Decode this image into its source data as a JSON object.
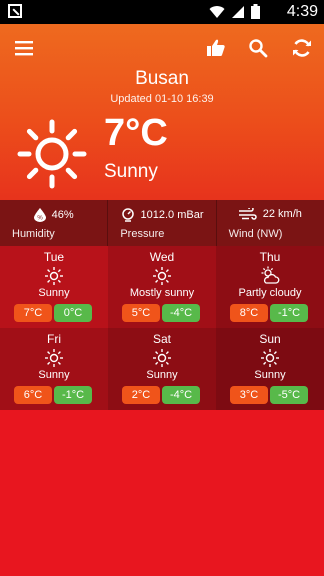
{
  "status_bar": {
    "time": "4:39"
  },
  "header": {
    "city": "Busan",
    "updated": "Updated 01-10 16:39"
  },
  "current": {
    "temperature": "7°C",
    "condition": "Sunny",
    "icon": "sun-icon"
  },
  "metrics": [
    {
      "value": "46%",
      "label": "Humidity",
      "icon": "humidity-icon"
    },
    {
      "value": "1012.0 mBar",
      "label": "Pressure",
      "icon": "pressure-icon"
    },
    {
      "value": "22 km/h",
      "label": "Wind (NW)",
      "icon": "wind-icon"
    }
  ],
  "forecast": [
    {
      "day": "Tue",
      "condition": "Sunny",
      "max": "7°C",
      "min": "0°C",
      "icon": "sun-icon"
    },
    {
      "day": "Wed",
      "condition": "Mostly sunny",
      "max": "5°C",
      "min": "-4°C",
      "icon": "sun-icon"
    },
    {
      "day": "Thu",
      "condition": "Partly cloudy",
      "max": "8°C",
      "min": "-1°C",
      "icon": "partly-cloudy-icon"
    },
    {
      "day": "Fri",
      "condition": "Sunny",
      "max": "6°C",
      "min": "-1°C",
      "icon": "sun-icon"
    },
    {
      "day": "Sat",
      "condition": "Sunny",
      "max": "2°C",
      "min": "-4°C",
      "icon": "sun-icon"
    },
    {
      "day": "Sun",
      "condition": "Sunny",
      "max": "3°C",
      "min": "-5°C",
      "icon": "sun-icon"
    }
  ],
  "colors": {
    "max_badge": "#f0541a",
    "min_badge": "#58b94a",
    "background": "#e8161f"
  }
}
